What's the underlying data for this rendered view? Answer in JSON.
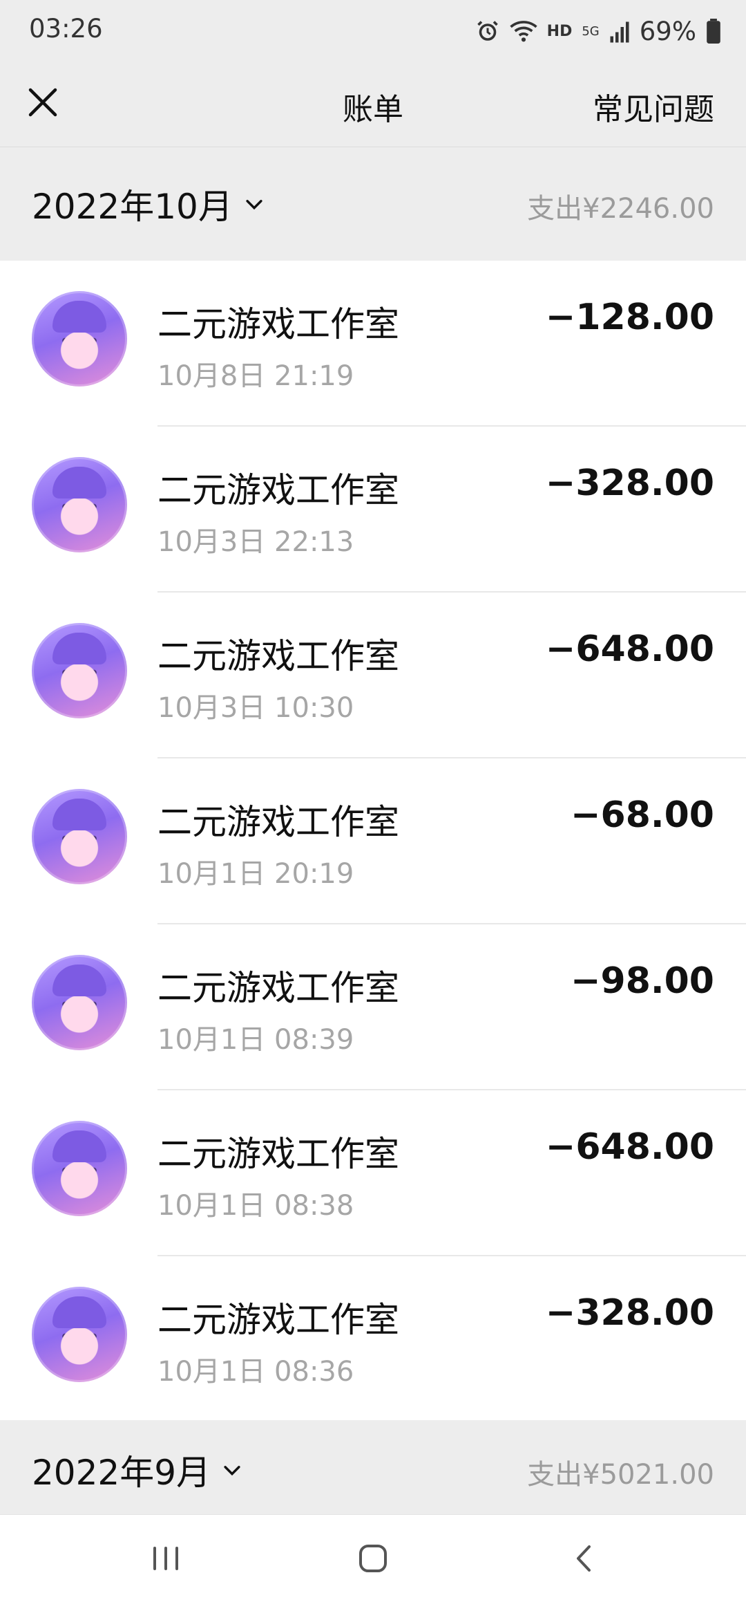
{
  "status": {
    "time": "03:26",
    "hd": "HD",
    "network": "5G",
    "battery": "69%"
  },
  "nav": {
    "title": "账单",
    "help": "常见问题"
  },
  "months": [
    {
      "label": "2022年10月",
      "total": "支出¥2246.00"
    },
    {
      "label": "2022年9月",
      "total": "支出¥5021.00"
    }
  ],
  "transactions": [
    {
      "merchant": "二元游戏工作室",
      "time": "10月8日 21:19",
      "amount": "−128.00"
    },
    {
      "merchant": "二元游戏工作室",
      "time": "10月3日 22:13",
      "amount": "−328.00"
    },
    {
      "merchant": "二元游戏工作室",
      "time": "10月3日 10:30",
      "amount": "−648.00"
    },
    {
      "merchant": "二元游戏工作室",
      "time": "10月1日 20:19",
      "amount": "−68.00"
    },
    {
      "merchant": "二元游戏工作室",
      "time": "10月1日 08:39",
      "amount": "−98.00"
    },
    {
      "merchant": "二元游戏工作室",
      "time": "10月1日 08:38",
      "amount": "−648.00"
    },
    {
      "merchant": "二元游戏工作室",
      "time": "10月1日 08:36",
      "amount": "−328.00"
    }
  ],
  "icons": {
    "close": "close-icon",
    "dropdown": "chevron-down-icon",
    "recents": "recents-icon",
    "home": "home-icon",
    "back": "back-icon"
  }
}
